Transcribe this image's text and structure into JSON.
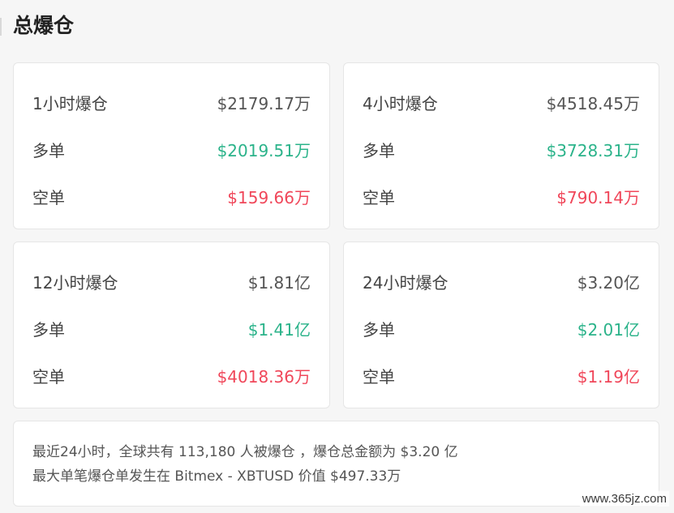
{
  "title": "总爆仓",
  "cards": [
    {
      "label": "1小时爆仓",
      "total": "$2179.17万",
      "long_label": "多单",
      "long": "$2019.51万",
      "short_label": "空单",
      "short": "$159.66万"
    },
    {
      "label": "4小时爆仓",
      "total": "$4518.45万",
      "long_label": "多单",
      "long": "$3728.31万",
      "short_label": "空单",
      "short": "$790.14万"
    },
    {
      "label": "12小时爆仓",
      "total": "$1.81亿",
      "long_label": "多单",
      "long": "$1.41亿",
      "short_label": "空单",
      "short": "$4018.36万"
    },
    {
      "label": "24小时爆仓",
      "total": "$3.20亿",
      "long_label": "多单",
      "long": "$2.01亿",
      "short_label": "空单",
      "short": "$1.19亿"
    }
  ],
  "summary": {
    "line1": "最近24小时，全球共有 113,180 人被爆仓 ，爆仓总金额为 $3.20 亿",
    "line2": "最大单笔爆仓单发生在 Bitmex - XBTUSD 价值 $497.33万"
  },
  "watermark": "www.365jz.com",
  "colors": {
    "long": "#2bb38a",
    "short": "#f0475a",
    "background": "#f6f6f6"
  }
}
